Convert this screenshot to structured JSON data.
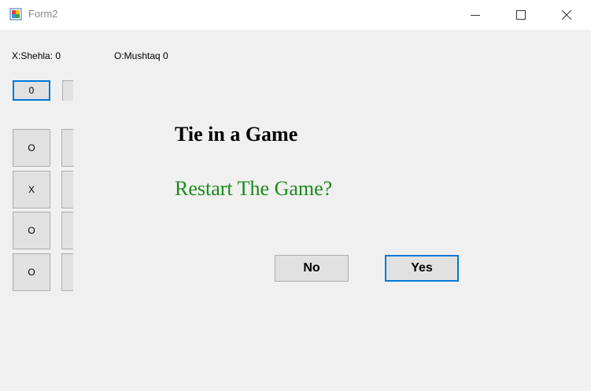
{
  "window": {
    "title": "Form2",
    "controls": {
      "minimize_icon": "minimize-icon",
      "maximize_icon": "maximize-icon",
      "close_icon": "close-icon"
    }
  },
  "scoreboard": {
    "player_x": "X:Shehla: 0",
    "player_o": "O:Mushtaq 0"
  },
  "top_row": {
    "first_label": "0",
    "second_label": "",
    "third_label": ""
  },
  "board_left_column": [
    "O",
    "X",
    "O",
    "O"
  ],
  "dialog": {
    "title": "Tie in a Game",
    "message": "Restart The Game?",
    "no_label": "No",
    "yes_label": "Yes"
  },
  "colors": {
    "accent_focus": "#0078d7",
    "message_green": "#1b8a1b",
    "background": "#f0f0f0"
  }
}
